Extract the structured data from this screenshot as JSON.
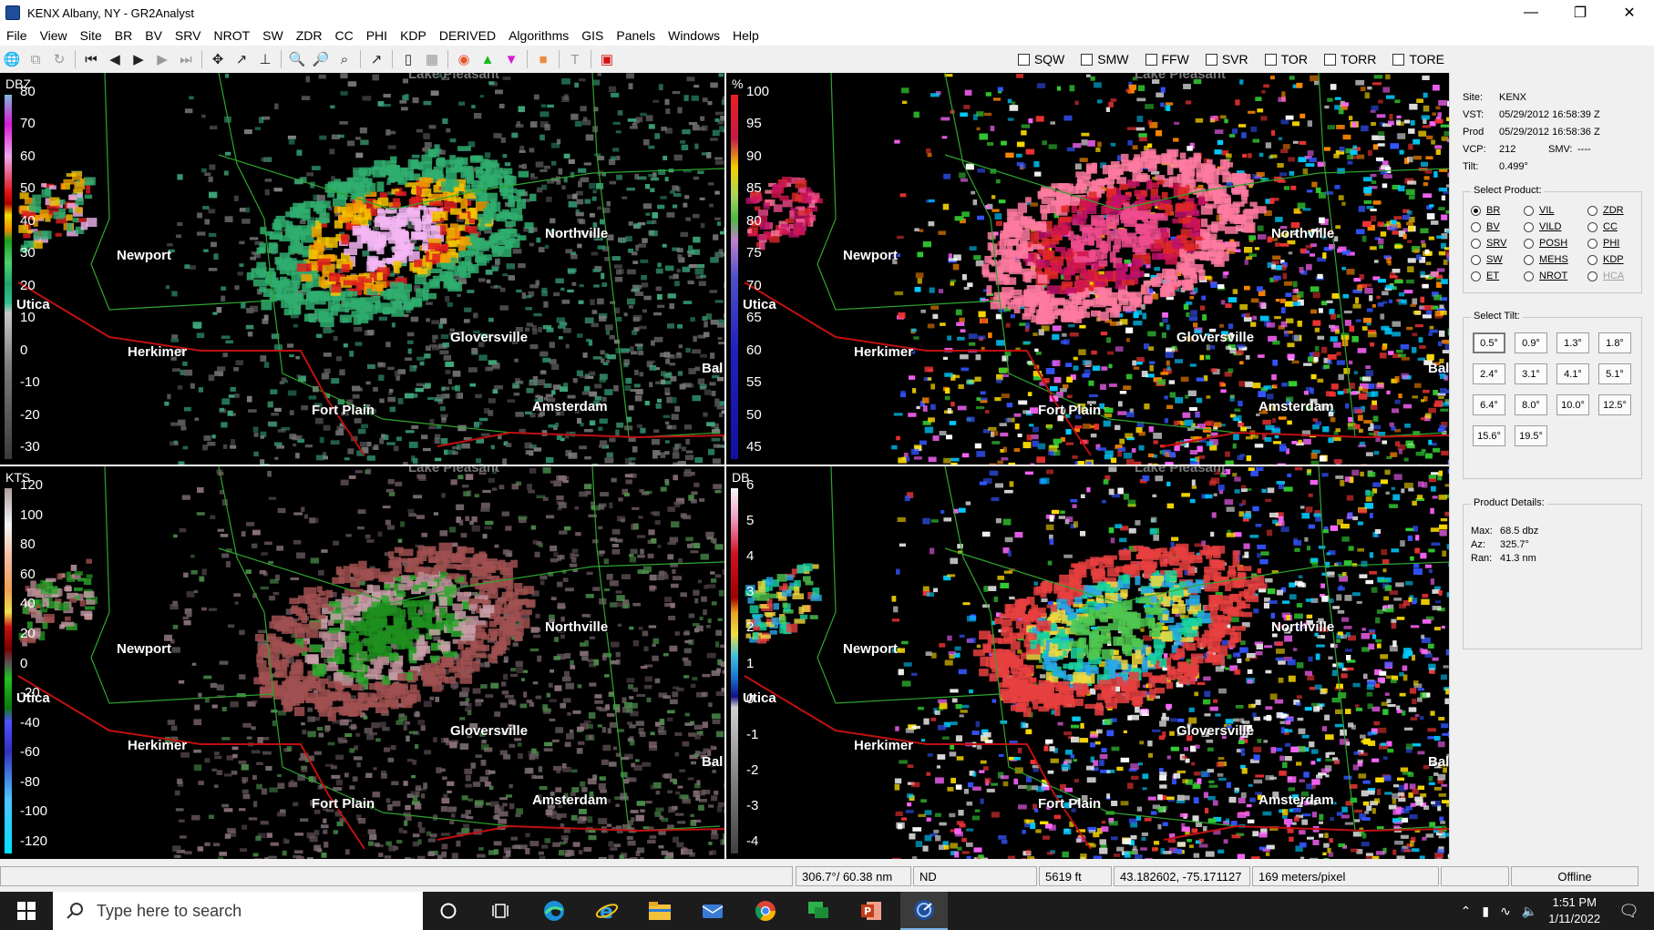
{
  "window": {
    "title": "KENX Albany, NY - GR2Analyst"
  },
  "menu": [
    "File",
    "View",
    "Site",
    "BR",
    "BV",
    "SRV",
    "NROT",
    "SW",
    "ZDR",
    "CC",
    "PHI",
    "KDP",
    "DERIVED",
    "Algorithms",
    "GIS",
    "Panels",
    "Windows",
    "Help"
  ],
  "warnings": [
    "SQW",
    "SMW",
    "FFW",
    "SVR",
    "TOR",
    "TORR",
    "TORE"
  ],
  "panels": [
    {
      "unit": "DBZ",
      "ticks": [
        "80",
        "70",
        "60",
        "50",
        "40",
        "30",
        "20",
        "10",
        "0",
        "-10",
        "-20",
        "-30"
      ]
    },
    {
      "unit": "%",
      "ticks": [
        "100",
        "95",
        "90",
        "85",
        "80",
        "75",
        "70",
        "65",
        "60",
        "55",
        "50",
        "45"
      ]
    },
    {
      "unit": "KTS",
      "ticks": [
        "120",
        "100",
        "80",
        "60",
        "40",
        "20",
        "0",
        "-20",
        "-40",
        "-60",
        "-80",
        "-100",
        "-120"
      ]
    },
    {
      "unit": "DB",
      "ticks": [
        "6",
        "5",
        "4",
        "3",
        "2",
        "1",
        "0",
        "-1",
        "-2",
        "-3",
        "-4"
      ]
    }
  ],
  "cities": {
    "newport": "Newport",
    "northville": "Northville",
    "utica": "Utica",
    "herkimer": "Herkimer",
    "gloversville": "Gloversville",
    "fort_plain": "Fort Plain",
    "amsterdam": "Amsterdam",
    "ballston": "Bal",
    "lake_pleasant": "Lake Pleasant"
  },
  "site_info": {
    "site_label": "Site:",
    "site": "KENX",
    "vst_label": "VST:",
    "vst": "05/29/2012  16:58:39 Z",
    "prod_label": "Prod",
    "prod": "05/29/2012  16:58:36 Z",
    "vcp_label": "VCP:",
    "vcp": "212",
    "smv_label": "SMV:",
    "smv": "----",
    "tilt_label": "Tilt:",
    "tilt": "0.499°"
  },
  "select_product": {
    "title": "Select Product:",
    "options": [
      "BR",
      "VIL",
      "ZDR",
      "BV",
      "VILD",
      "CC",
      "SRV",
      "POSH",
      "PHI",
      "SW",
      "MEHS",
      "KDP",
      "ET",
      "NROT",
      "HCA"
    ],
    "selected": "BR",
    "disabled": [
      "HCA"
    ]
  },
  "select_tilt": {
    "title": "Select Tilt:",
    "tilts": [
      "0.5°",
      "0.9°",
      "1.3°",
      "1.8°",
      "2.4°",
      "3.1°",
      "4.1°",
      "5.1°",
      "6.4°",
      "8.0°",
      "10.0°",
      "12.5°",
      "15.6°",
      "19.5°"
    ],
    "selected": "0.5°"
  },
  "product_details": {
    "title": "Product Details:",
    "max_label": "Max:",
    "max": "68.5 dbz",
    "az_label": "Az:",
    "az": "325.7°",
    "ran_label": "Ran:",
    "ran": "41.3 nm"
  },
  "status": {
    "azimuth_range": "306.7°/ 60.38 nm",
    "value": "ND",
    "height": "5619 ft",
    "latlon": "43.182602, -75.171127",
    "resolution": "169 meters/pixel",
    "connection": "Offline"
  },
  "taskbar": {
    "search_placeholder": "Type here to search",
    "time": "1:51 PM",
    "date": "1/11/2022"
  }
}
